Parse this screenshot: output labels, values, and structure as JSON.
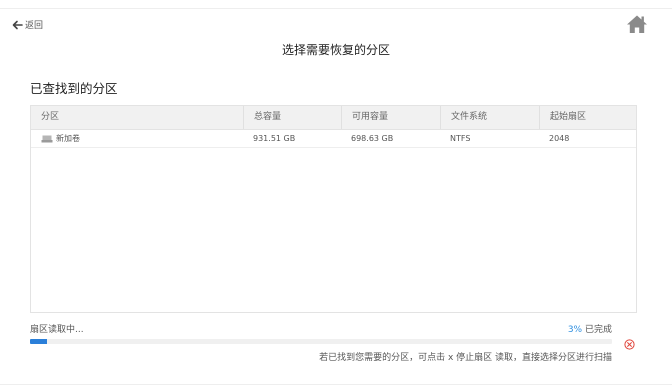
{
  "header": {
    "back_label": "返回",
    "title": "选择需要恢复的分区"
  },
  "found": {
    "title": "已查找到的分区",
    "columns": [
      "分区",
      "总容量",
      "可用容量",
      "文件系统",
      "起始扇区"
    ],
    "rows": [
      {
        "name": "新加卷",
        "total": "931.51 GB",
        "free": "698.63 GB",
        "fs": "NTFS",
        "start": "2048"
      }
    ]
  },
  "progress": {
    "status": "扇区读取中...",
    "percent": 3,
    "percent_text": "3%",
    "done_label": "已完成",
    "hint": "若已找到您需要的分区，可点击 x 停止扇区 读取，直接选择分区进行扫描"
  },
  "colors": {
    "accent": "#2a7fd9",
    "stop": "#e0443a",
    "header_bg": "#f1f1f1"
  },
  "icons": [
    "back-arrow-icon",
    "home-icon",
    "drive-icon",
    "stop-icon"
  ]
}
